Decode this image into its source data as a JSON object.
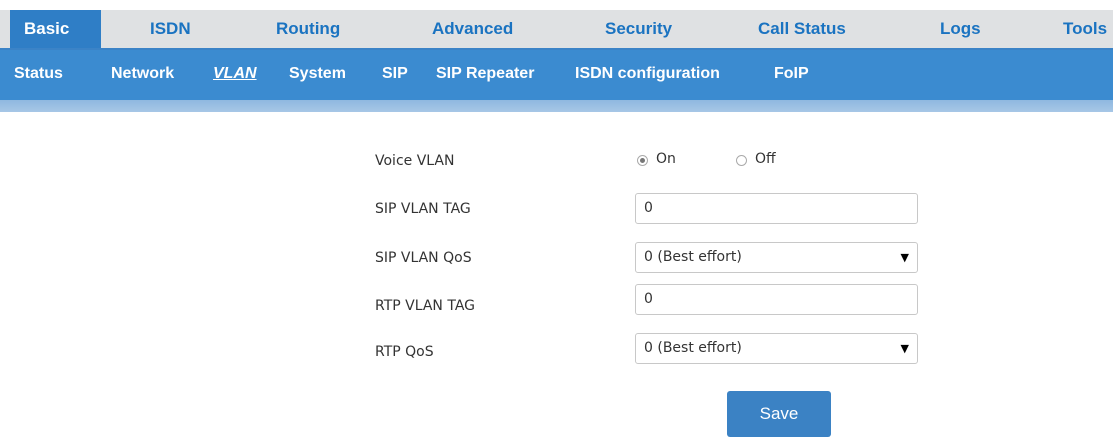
{
  "top_nav": {
    "tabs": [
      "Basic",
      "ISDN",
      "Routing",
      "Advanced",
      "Security",
      "Call Status",
      "Logs",
      "Tools"
    ],
    "active": "Basic"
  },
  "sub_nav": {
    "items": [
      "Status",
      "Network",
      "VLAN",
      "System",
      "SIP",
      "SIP Repeater",
      "ISDN configuration",
      "FoIP"
    ],
    "active": "VLAN"
  },
  "form": {
    "voice_vlan": {
      "label": "Voice VLAN",
      "options": [
        "On",
        "Off"
      ],
      "selected": "On"
    },
    "sip_vlan_tag": {
      "label": "SIP VLAN TAG",
      "value": "0"
    },
    "sip_vlan_qos": {
      "label": "SIP VLAN QoS",
      "value": "0 (Best effort)"
    },
    "rtp_vlan_tag": {
      "label": "RTP VLAN TAG",
      "value": "0"
    },
    "rtp_qos": {
      "label": "RTP QoS",
      "value": "0 (Best effort)"
    },
    "save_label": "Save"
  },
  "colors": {
    "accent": "#3b82c4",
    "nav_active": "#2f7ec6",
    "nav_text": "#1a73c1"
  }
}
